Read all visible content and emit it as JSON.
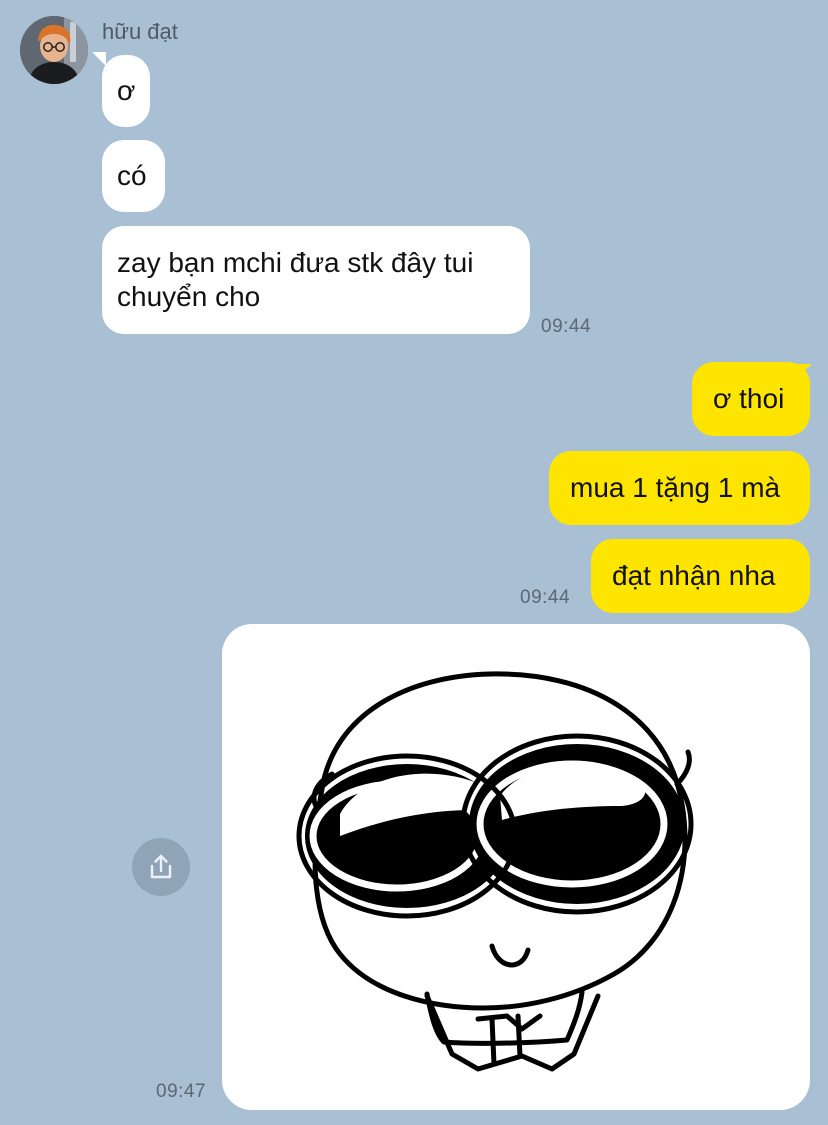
{
  "contact": {
    "name": "hữu đạt"
  },
  "incoming": [
    {
      "text": "ơ"
    },
    {
      "text": "có"
    },
    {
      "text_line1": "zay bạn mchi đưa stk đây tui",
      "text_line2": "chuyển cho"
    }
  ],
  "incoming_time": "09:44",
  "outgoing": [
    {
      "text": "ơ thoi"
    },
    {
      "text": "mua 1 tặng 1 mà"
    },
    {
      "text": "đạt nhận nha"
    }
  ],
  "outgoing_time": "09:44",
  "sticker": {
    "time": "09:47",
    "share_icon": "share-icon"
  },
  "colors": {
    "background": "#a9bfd3",
    "incoming_bubble": "#ffffff",
    "outgoing_bubble": "#fee500"
  }
}
